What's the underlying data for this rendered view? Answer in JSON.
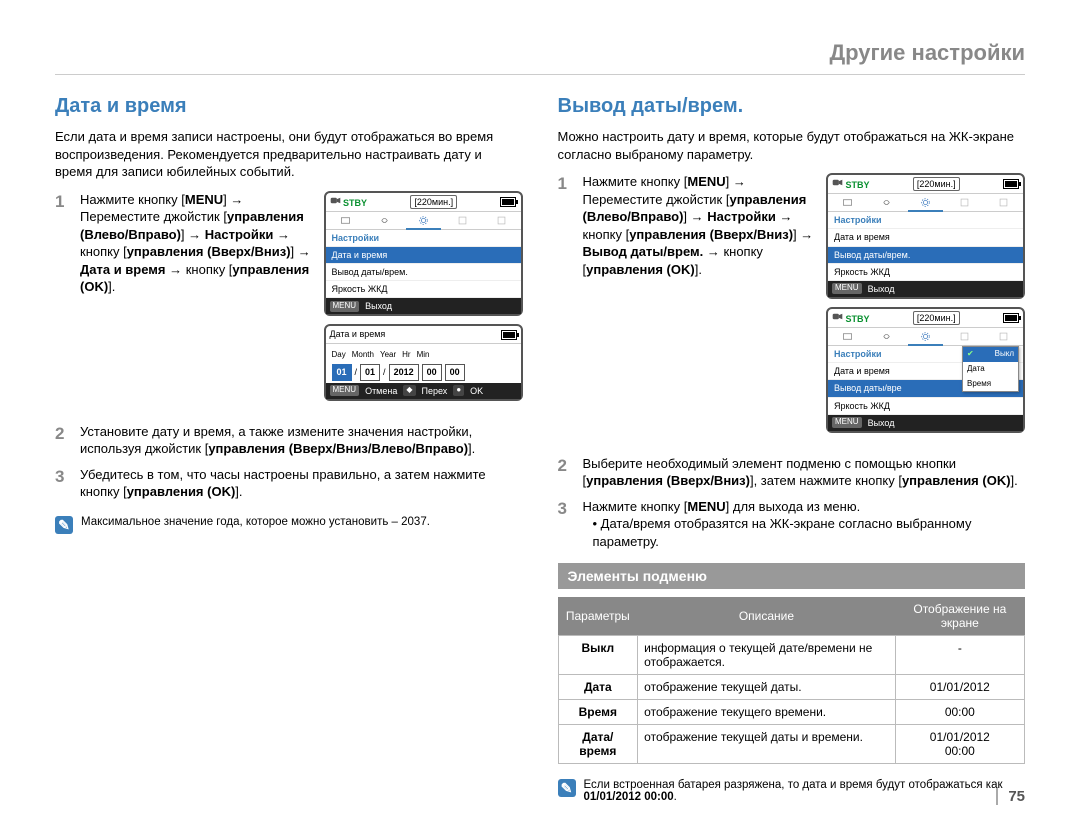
{
  "header": {
    "title": "Другие настройки"
  },
  "page_number": "75",
  "left": {
    "section_title": "Дата и время",
    "intro": "Если дата и время записи настроены, они будут отображаться во время воспроизведения. Рекомендуется предварительно настраивать дату и время для записи юбилейных событий.",
    "step1_parts": {
      "a": "Нажмите кнопку [",
      "b": "MENU",
      "c": "] → Переместите джойстик [",
      "d": "управления (Влево/Вправо)",
      "e": "] → ",
      "f": "Настройки",
      "g": " → кнопку [",
      "h": "управления (Вверх/Вниз)",
      "i": "] → ",
      "j": "Дата и время",
      "k": " → кнопку [",
      "l": "управления (OK)",
      "m": "]."
    },
    "step2_parts": {
      "a": "Установите дату и время, а также измените значения настройки, используя джойстик [",
      "b": "управления (Вверх/Вниз/Влево/Вправо)",
      "c": "]."
    },
    "step3_parts": {
      "a": "Убедитесь в том, что часы настроены правильно, а затем нажмите кнопку [",
      "b": "управления (OK)",
      "c": "]."
    },
    "note": "Максимальное значение года, которое можно установить – 2037.",
    "lcd1": {
      "stby": "STBY",
      "time": "[220мин.]",
      "header": "Настройки",
      "rows": [
        "Дата и время",
        "Вывод даты/врем.",
        "Яркость ЖКД"
      ],
      "selected_index": 0,
      "exit": "Выход",
      "menu": "MENU"
    },
    "lcd2": {
      "title": "Дата и время",
      "labels": [
        "Day",
        "Month",
        "Year",
        "Hr",
        "Min"
      ],
      "values": [
        "01",
        "01",
        "2012",
        "00",
        "00"
      ],
      "menu": "MENU",
      "cancel": "Отмена",
      "move": "Перех",
      "ok": "OK"
    }
  },
  "right": {
    "section_title": "Вывод даты/врем.",
    "intro": "Можно настроить дату и время, которые будут отображаться на ЖК-экране согласно выбраному параметру.",
    "step1_parts": {
      "a": "Нажмите кнопку [",
      "b": "MENU",
      "c": "] → Переместите джойстик [",
      "d": "управления (Влево/Вправо)",
      "e": "] → ",
      "f": "Настройки",
      "g": " → кнопку [",
      "h": "управления (Вверх/Вниз)",
      "i": "] → ",
      "j": "Вывод даты/врем.",
      "k": " → кнопку [",
      "l": "управления (OK)",
      "m": "]."
    },
    "step2_parts": {
      "a": "Выберите необходимый элемент подменю с помощью кнопки [",
      "b": "управления (Вверх/Вниз)",
      "c": "], затем нажмите кнопку [",
      "d": "управления (OK)",
      "e": "]."
    },
    "step3_parts": {
      "a": "Нажмите кнопку [",
      "b": "MENU",
      "c": "] для выхода из меню."
    },
    "step3_bullet": "Дата/время отобразятся на ЖК-экране согласно выбранному параметру.",
    "lcd1": {
      "stby": "STBY",
      "time": "[220мин.]",
      "header": "Настройки",
      "rows": [
        "Дата и время",
        "Вывод даты/врем.",
        "Яркость ЖКД"
      ],
      "selected_index": 1,
      "exit": "Выход",
      "menu": "MENU"
    },
    "lcd2": {
      "stby": "STBY",
      "time": "[220мин.]",
      "header": "Настройки",
      "rows": [
        "Дата и время",
        "Вывод даты/вре",
        "Яркость ЖКД"
      ],
      "popup": [
        "Выкл",
        "Дата",
        "Время"
      ],
      "popup_sel": 0,
      "exit": "Выход",
      "menu": "MENU"
    },
    "submenu_heading": "Элементы подменю",
    "table_head": [
      "Параметры",
      "Описание",
      "Отображение на экране"
    ],
    "table_rows": [
      {
        "param": "Выкл",
        "desc": "информация о текущей дате/времени не отображается.",
        "display": "-"
      },
      {
        "param": "Дата",
        "desc": "отображение текущей даты.",
        "display": "01/01/2012"
      },
      {
        "param": "Время",
        "desc": "отображение текущего времени.",
        "display": "00:00"
      },
      {
        "param": "Дата/время",
        "desc": "отображение текущей даты и времени.",
        "display": "01/01/2012\n00:00"
      }
    ],
    "footnote_parts": {
      "a": "Если встроенная батарея разряжена, то дата и время будут отображаться как ",
      "b": "01/01/2012 00:00",
      "c": "."
    }
  }
}
